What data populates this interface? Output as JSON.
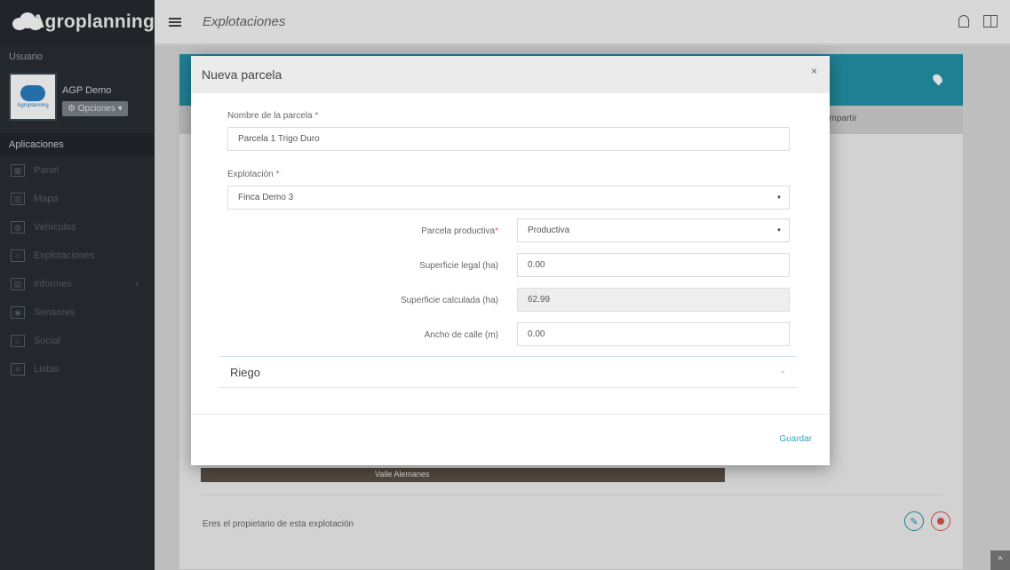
{
  "brand": {
    "name": "Agroplanning",
    "logo_text": "Agroplanning"
  },
  "user": {
    "section_label": "Usuario",
    "name": "AGP Demo",
    "options_label": "Opciones"
  },
  "nav": {
    "section_label": "Aplicaciones",
    "items": [
      {
        "label": "Panel",
        "icon": "panel-icon"
      },
      {
        "label": "Mapa",
        "icon": "map-icon"
      },
      {
        "label": "Vehículos",
        "icon": "vehicle-icon"
      },
      {
        "label": "Explotaciones",
        "icon": "farm-icon"
      },
      {
        "label": "Informes",
        "icon": "reports-icon"
      },
      {
        "label": "Sensores",
        "icon": "sensor-icon"
      },
      {
        "label": "Social",
        "icon": "social-icon"
      },
      {
        "label": "Listas",
        "icon": "list-icon"
      }
    ]
  },
  "topbar": {
    "title": "Explotaciones"
  },
  "background": {
    "share_tab": "ompartir",
    "map_label": "Valle Alemanes",
    "owner_text": "Eres el propietario de esta explotación"
  },
  "modal": {
    "title": "Nueva parcela",
    "close": "×",
    "fields": {
      "name": {
        "label": "Nombre de la parcela",
        "value": "Parcela 1 Trigo Duro"
      },
      "farm": {
        "label": "Explotación",
        "value": "Finca Demo 3"
      },
      "productive": {
        "label": "Parcela productiva",
        "value": "Productiva"
      },
      "legal_area": {
        "label": "Superficie legal (ha)",
        "value": "0.00"
      },
      "calc_area": {
        "label": "Superficie calculada (ha)",
        "value": "62.99"
      },
      "street_width": {
        "label": "Ancho de calle (m)",
        "value": "0.00"
      }
    },
    "required_mark": "*",
    "section_riego": "Riego",
    "save_label": "Guardar"
  },
  "colors": {
    "teal": "#2592a8",
    "sidebar": "#2a2d33",
    "link": "#2fa7c9",
    "danger": "#d9534f"
  }
}
